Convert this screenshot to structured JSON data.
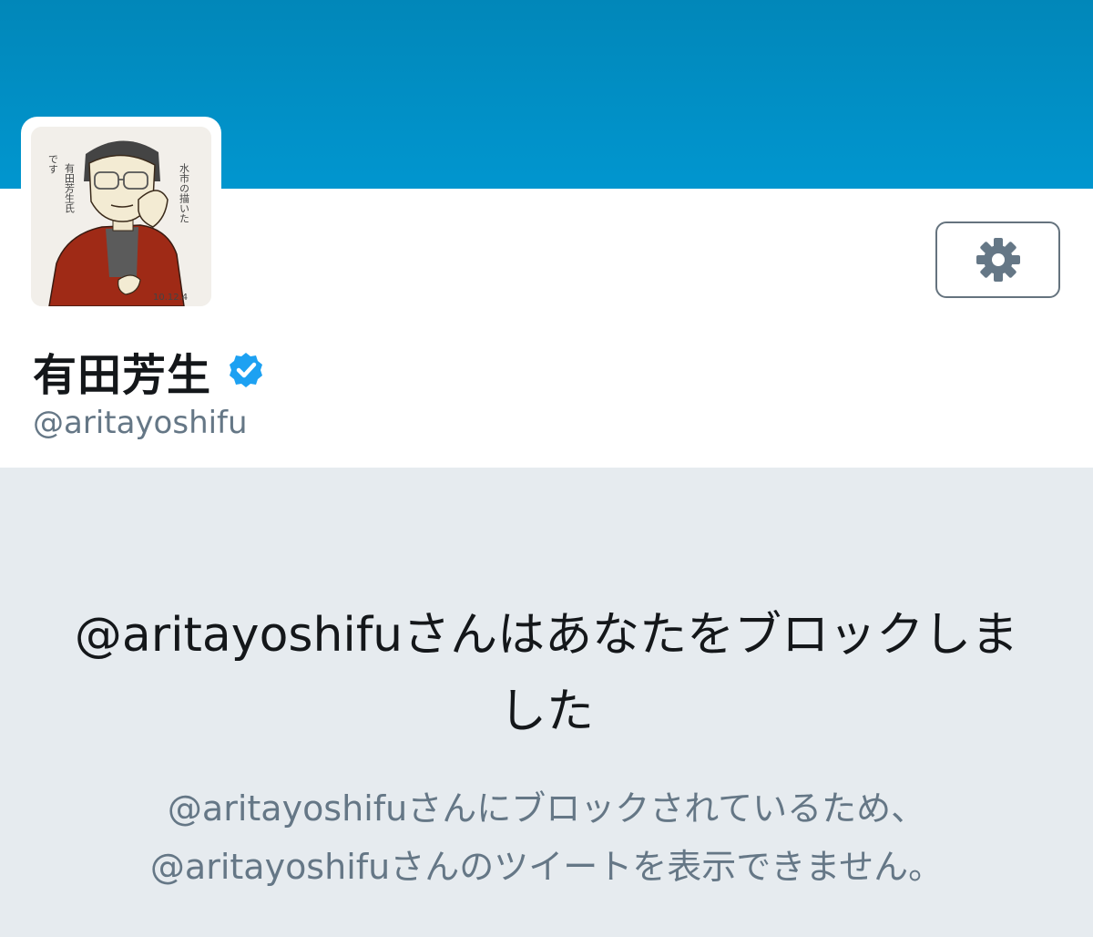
{
  "profile": {
    "display_name": "有田芳生",
    "handle": "@aritayoshifu",
    "verified": true
  },
  "avatar": {
    "caption": "水市の描いた 有田芳生氏 です",
    "date": "10.12.4"
  },
  "settings": {
    "icon": "gear-icon"
  },
  "blocked": {
    "title": "@aritayoshifuさんはあなたをブロックしました",
    "description_line1": "@aritayoshifuさんにブロックされているため、",
    "description_line2": "@aritayoshifuさんのツイートを表示できません。"
  },
  "colors": {
    "banner": "#0190c6",
    "verified_badge": "#1da1f2",
    "secondary_text": "#657786",
    "background": "#e6ebef"
  }
}
